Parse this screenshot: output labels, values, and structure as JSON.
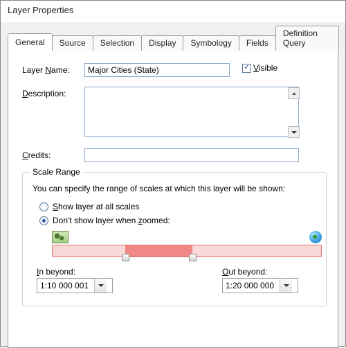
{
  "title": "Layer Properties",
  "tabs": {
    "general": "General",
    "source": "Source",
    "selection": "Selection",
    "display": "Display",
    "symbology": "Symbology",
    "fields": "Fields",
    "definition_query": "Definition Query"
  },
  "labels": {
    "layer_name": "Layer Name:",
    "visible": "Visible",
    "description": "Description:",
    "credits": "Credits:"
  },
  "fields": {
    "layer_name": "Major Cities (State)",
    "description": "",
    "credits": ""
  },
  "underlines": {
    "layer_name_u": "N",
    "visible_u": "V",
    "description_u": "D",
    "credits_u": "C",
    "show_u": "S",
    "zoomed_u": "z",
    "in_u": "I",
    "out_u": "O"
  },
  "scale_range": {
    "legend": "Scale Range",
    "help": "You can specify the range of scales at which this layer will be shown:",
    "opt_all": "Show layer at all scales",
    "opt_zoom": "Don't show layer when zoomed:",
    "in_beyond_label": "In beyond:",
    "out_beyond_label": "Out beyond:",
    "in_beyond": "1:10 000 001",
    "out_beyond": "1:20 000 000"
  }
}
